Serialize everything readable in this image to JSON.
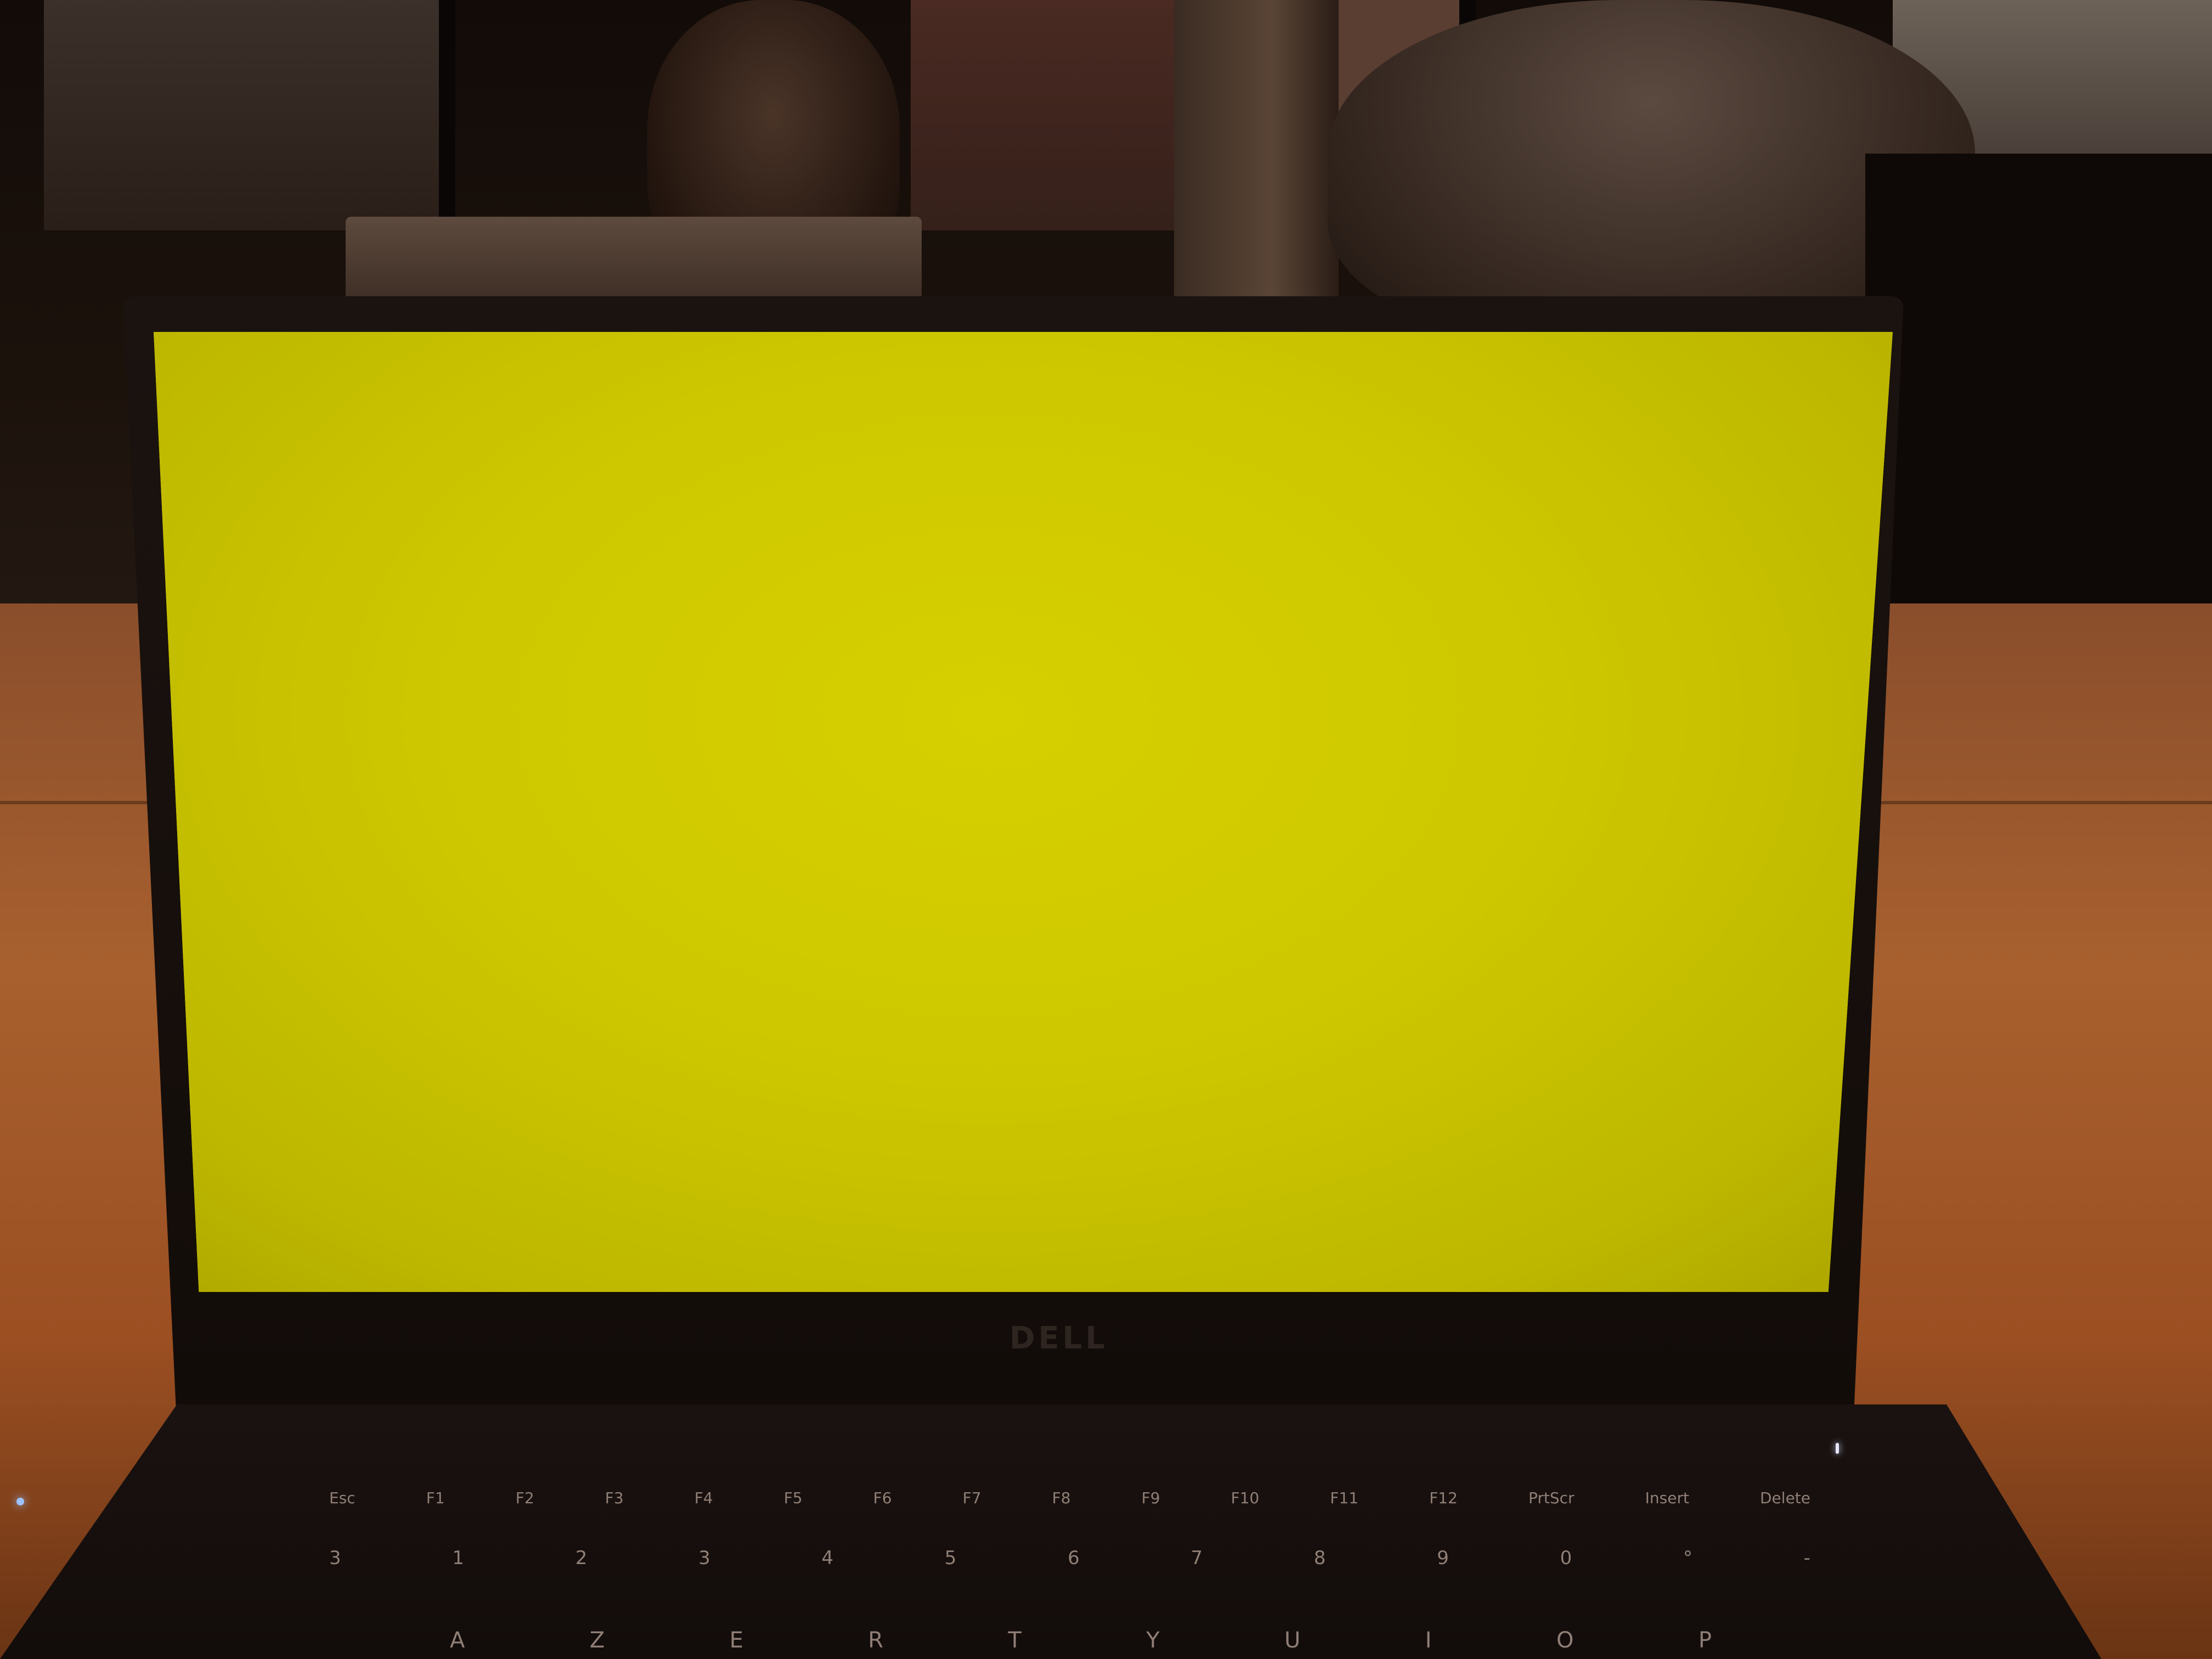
{
  "screen": {
    "color": "#d2cc00"
  },
  "laptop": {
    "brand": "DELL",
    "function_keys": [
      "Esc",
      "F1",
      "F2",
      "F3",
      "F4",
      "F5",
      "F6",
      "F7",
      "F8",
      "F9",
      "F10",
      "F11",
      "F12",
      "PrtScr",
      "Insert",
      "Delete"
    ],
    "number_keys": [
      "3",
      "1",
      "2",
      "3",
      "4",
      "5",
      "6",
      "7",
      "8",
      "9",
      "0",
      "°",
      "-"
    ],
    "letter_keys": [
      "A",
      "Z",
      "E",
      "R",
      "T",
      "Y",
      "U",
      "I",
      "O",
      "P"
    ]
  }
}
